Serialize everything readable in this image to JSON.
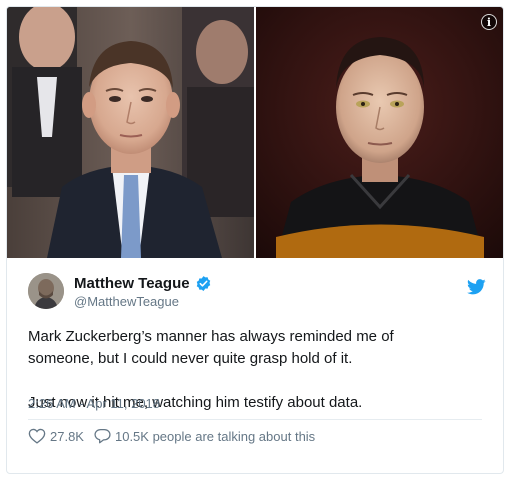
{
  "media": {
    "info_glyph": "i",
    "left_photo": "man-in-suit-photo",
    "right_photo": "android-character-photo"
  },
  "tweet": {
    "author_name": "Matthew Teague",
    "author_handle": "@MatthewTeague",
    "text_line1": "Mark Zuckerberg’s manner has always reminded me of",
    "text_line2": "someone, but I could never quite grasp hold of it.",
    "text_line3": "Just now it hit me, watching him testify about data.",
    "timestamp": "2:26 AM - Apr 11, 2018",
    "likes": "27.8K",
    "talking": "10.5K people are talking about this"
  },
  "icons": {
    "verified": "verified-badge-icon",
    "brand": "twitter-bird-icon",
    "like": "heart-icon",
    "reply": "speech-bubble-icon"
  },
  "colors": {
    "accent": "#1da1f2",
    "secondary_text": "#657786",
    "primary_text": "#14171a",
    "border": "#e1e8ed"
  }
}
